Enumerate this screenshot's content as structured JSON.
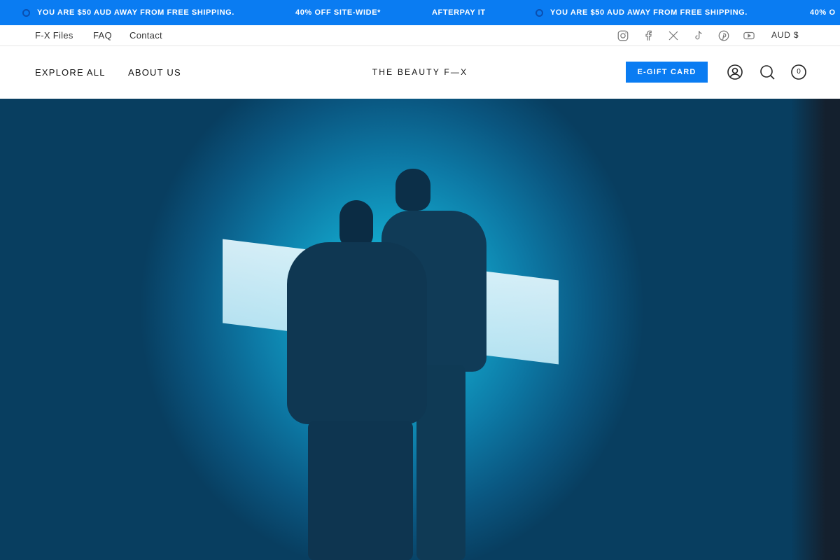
{
  "announcement": {
    "items": [
      {
        "text": "YOU ARE $50 AUD AWAY FROM FREE SHIPPING.",
        "dot": true
      },
      {
        "text": "40% OFF SITE-WIDE*",
        "dot": false
      },
      {
        "text": "AFTERPAY IT",
        "dot": false
      },
      {
        "text": "YOU ARE $50 AUD AWAY FROM FREE SHIPPING.",
        "dot": true
      },
      {
        "text": "40% O",
        "dot": false
      }
    ],
    "accent": "#0a7cf2"
  },
  "utility": {
    "links": [
      "F-X Files",
      "FAQ",
      "Contact"
    ],
    "social_icons": [
      "instagram-icon",
      "facebook-icon",
      "x-icon",
      "tiktok-icon",
      "pinterest-icon",
      "youtube-icon"
    ],
    "currency": "AUD $"
  },
  "nav": {
    "explore": "EXPLORE ALL",
    "about": "ABOUT US",
    "logo": "THE BEAUTY F—X",
    "egift": "E-GIFT CARD",
    "icons": [
      "account-icon",
      "search-icon",
      "cart-icon"
    ],
    "cart_count": "0"
  },
  "hero": {
    "image": "two silhouetted figures in metallic puffer jackets against a blue backdrop with a white panel"
  }
}
